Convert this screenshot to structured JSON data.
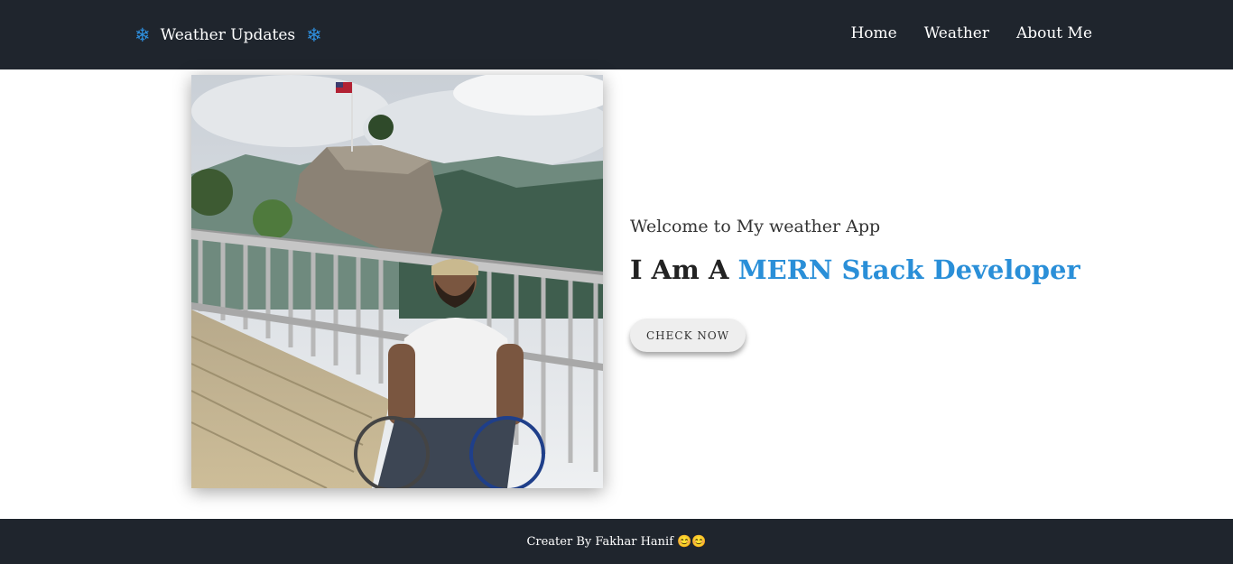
{
  "navbar": {
    "brand": {
      "label": "Weather Updates",
      "icon_left": "❄",
      "icon_right": "❄",
      "icon_color": "#2e8fde"
    },
    "links": [
      {
        "label": "Home"
      },
      {
        "label": "Weather"
      },
      {
        "label": "About Me"
      }
    ],
    "background": "#1f252d"
  },
  "hero": {
    "photo": {
      "alt": "Man in a wheelchair on a mountain boardwalk"
    },
    "welcome": "Welcome to My weather App",
    "headline_prefix": "I Am A",
    "headline_accent": "MERN Stack Developer",
    "accent_color": "#2a8fd8",
    "cta_label": "CHECK NOW"
  },
  "footer": {
    "text": "Creater By Fakhar Hanif 😊😊"
  }
}
